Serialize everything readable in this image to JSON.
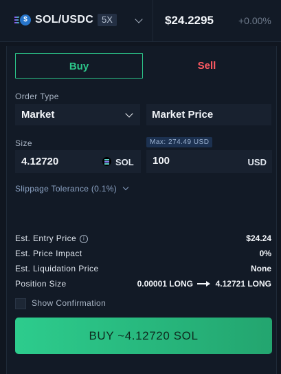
{
  "header": {
    "pair": "SOL/USDC",
    "leverage": "5X",
    "price": "$24.2295",
    "change": "+0.00%"
  },
  "tabs": {
    "buy": "Buy",
    "sell": "Sell",
    "active": "Buy"
  },
  "order_type": {
    "label": "Order Type",
    "value": "Market",
    "price_field": "Market Price"
  },
  "size": {
    "label": "Size",
    "amount": "4.12720",
    "amount_unit": "SOL",
    "max_badge": "Max: 274.49 USD",
    "usd_amount": "100",
    "usd_unit": "USD"
  },
  "slippage": "Slippage Tolerance (0.1%)",
  "summary": [
    {
      "label": "Est. Entry Price",
      "value": "$24.24",
      "info": true
    },
    {
      "label": "Est. Price Impact",
      "value": "0%"
    },
    {
      "label": "Est. Liquidation Price",
      "value": "None"
    }
  ],
  "position_size": {
    "label": "Position Size",
    "from": "0.00001 LONG",
    "to": "4.12721 LONG"
  },
  "show_confirmation": {
    "label": "Show Confirmation",
    "checked": false
  },
  "submit_button": "BUY ~4.12720 SOL",
  "colors": {
    "buy": "#2cc68a",
    "sell": "#ff5a63",
    "background": "#101620",
    "panel": "#121a26"
  },
  "icons": [
    "usdc-coin-icon",
    "solana-logo-icon",
    "chevron-down-icon",
    "info-icon",
    "arrow-right-icon"
  ]
}
